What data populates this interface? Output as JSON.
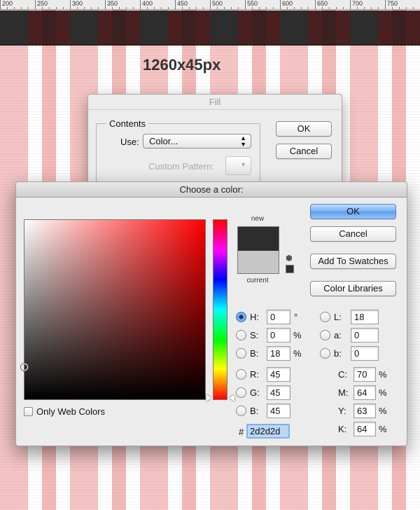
{
  "ruler": {
    "ticks": [
      "200",
      "250",
      "300",
      "350",
      "400",
      "450",
      "500",
      "550",
      "600",
      "650",
      "700",
      "750"
    ]
  },
  "canvas": {
    "size_label": "1260x45px"
  },
  "fill_dialog": {
    "title": "Fill",
    "contents_legend": "Contents",
    "use_label": "Use:",
    "use_value": "Color...",
    "custom_pattern_label": "Custom Pattern:",
    "ok_label": "OK",
    "cancel_label": "Cancel"
  },
  "color_picker": {
    "title": "Choose a color:",
    "new_label": "new",
    "current_label": "current",
    "new_color": "#2d2d2d",
    "current_color": "#c6c6c6",
    "buttons": {
      "ok": "OK",
      "cancel": "Cancel",
      "add_swatches": "Add To Swatches",
      "color_libraries": "Color Libraries"
    },
    "hsb": {
      "h_label": "H:",
      "h_value": "0",
      "h_unit": "°",
      "s_label": "S:",
      "s_value": "0",
      "s_unit": "%",
      "b_label": "B:",
      "b_value": "18",
      "b_unit": "%"
    },
    "rgb": {
      "r_label": "R:",
      "r_value": "45",
      "g_label": "G:",
      "g_value": "45",
      "b_label": "B:",
      "b_value": "45"
    },
    "lab": {
      "l_label": "L:",
      "l_value": "18",
      "a_label": "a:",
      "a_value": "0",
      "b_label": "b:",
      "b_value": "0"
    },
    "cmyk": {
      "c_label": "C:",
      "c_value": "70",
      "m_label": "M:",
      "m_value": "64",
      "y_label": "Y:",
      "y_value": "63",
      "k_label": "K:",
      "k_value": "64",
      "unit": "%"
    },
    "hex_prefix": "#",
    "hex_value": "2d2d2d",
    "only_web_colors": "Only Web Colors"
  },
  "icons": {
    "cube": "cube-icon",
    "selected_radio": "hue"
  }
}
